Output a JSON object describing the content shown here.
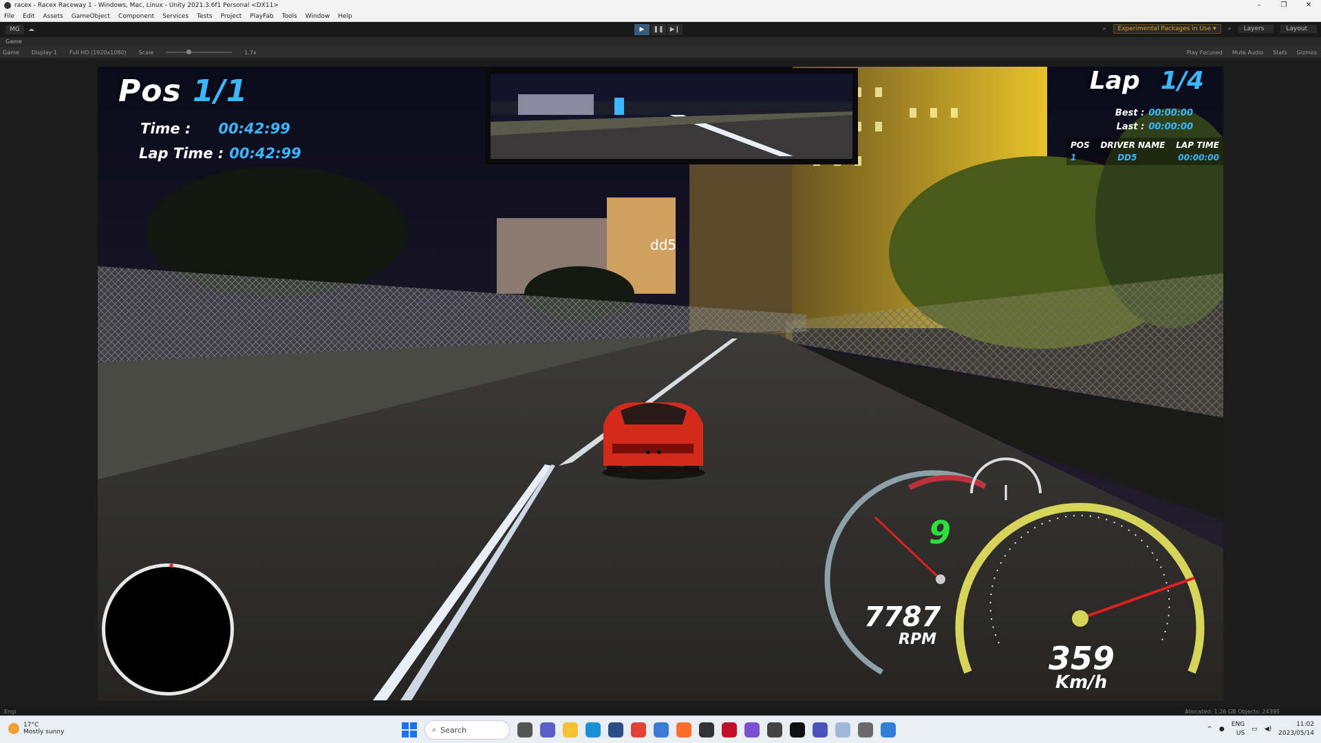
{
  "window": {
    "title": "racex - Racex Raceway 1 - Windows, Mac, Linux - Unity 2021.3.6f1 Personal <DX11>",
    "controls": [
      "–",
      "❐",
      "✕"
    ]
  },
  "menu": [
    "File",
    "Edit",
    "Assets",
    "GameObject",
    "Component",
    "Services",
    "Tests",
    "Project",
    "PlayFab",
    "Tools",
    "Window",
    "Help"
  ],
  "toolbar": {
    "account": "MG",
    "play_icon": "▶",
    "pause_icon": "❚❚",
    "step_icon": "▶❙",
    "packages_label": "Experimental Packages in Use ▾",
    "layers_label": "Layers",
    "layout_label": "Layout"
  },
  "game_tab": {
    "label": "Game"
  },
  "game_toolbar": {
    "mode": "Game",
    "display": "Display 1",
    "resolution": "Full HD (1920x1080)",
    "scale_label": "Scale",
    "scale_value": "1.7x",
    "play_focused": "Play Focused",
    "mute": "Mute Audio",
    "stats": "Stats",
    "gizmos": "Gizmos"
  },
  "hud": {
    "pos_label": "Pos",
    "pos_value": "1/1",
    "time_label": "Time :",
    "time_value": "00:42:99",
    "laptime_label": "Lap Time :",
    "laptime_value": "00:42:99",
    "lap_label": "Lap",
    "lap_value": "1/4",
    "best_label": "Best :",
    "best_value": "00:00:00",
    "last_label": "Last :",
    "last_value": "00:00:00",
    "leaderboard": {
      "headers": [
        "POS",
        "DRIVER NAME",
        "LAP TIME"
      ],
      "rows": [
        {
          "pos": "1",
          "name": "DD5",
          "time": "00:00:00"
        }
      ]
    },
    "player_tag": "dd5",
    "gear": "9",
    "rpm_value": "7787",
    "rpm_unit": "RPM",
    "speed_value": "359",
    "speed_unit": "Km/h",
    "speed_needle_fraction": 0.92,
    "rpm_needle_fraction": 0.55
  },
  "statusbar": {
    "left": "Engi",
    "right": "Allocated: 1.26 GB Objects: 24395"
  },
  "taskbar": {
    "weather_temp": "17°C",
    "weather_desc": "Mostly sunny",
    "search_placeholder": "Search",
    "lang_top": "ENG",
    "lang_bottom": "US",
    "time": "11:02",
    "date": "2023/05/14"
  },
  "colors": {
    "hud_accent": "#3ab7ff",
    "gear_green": "#2ddf3a",
    "speedo_yellow": "#d7d45a",
    "needle_red": "#e02020"
  }
}
